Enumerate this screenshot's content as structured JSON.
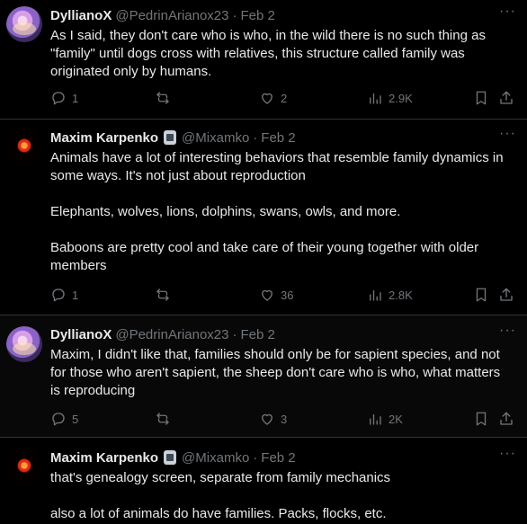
{
  "tweets": [
    {
      "name": "DyllianoX",
      "handle": "@PedrinArianox23",
      "sep": "·",
      "date": "Feb 2",
      "more": "···",
      "paragraphs": [
        "As I said, they don't care who is who, in the wild there is no such thing as \"family\" until dogs cross with relatives, this structure called family was originated only by humans."
      ],
      "replies": "1",
      "retweets": "",
      "likes": "2",
      "views": "2.9K"
    },
    {
      "name": "Maxim Karpenko",
      "handle": "@Mixamko",
      "sep": "·",
      "date": "Feb 2",
      "more": "···",
      "paragraphs": [
        "Animals have a lot of interesting behaviors that resemble family dynamics in some ways. It's not just about reproduction",
        "Elephants, wolves, lions, dolphins, swans, owls, and more.",
        "Baboons are pretty cool and take care of their young together with older members"
      ],
      "replies": "1",
      "retweets": "",
      "likes": "36",
      "views": "2.8K"
    },
    {
      "name": "DyllianoX",
      "handle": "@PedrinArianox23",
      "sep": "·",
      "date": "Feb 2",
      "more": "···",
      "paragraphs": [
        "Maxim, I didn't like that, families should only be for sapient species, and not for those who aren't sapient, the sheep don't care who is who, what matters is reproducing"
      ],
      "replies": "5",
      "retweets": "",
      "likes": "3",
      "views": "2K"
    },
    {
      "name": "Maxim Karpenko",
      "handle": "@Mixamko",
      "sep": "·",
      "date": "Feb 2",
      "more": "···",
      "paragraphs": [
        "that's genealogy screen, separate from family mechanics",
        "also a lot of animals do have families. Packs, flocks, etc."
      ]
    }
  ]
}
